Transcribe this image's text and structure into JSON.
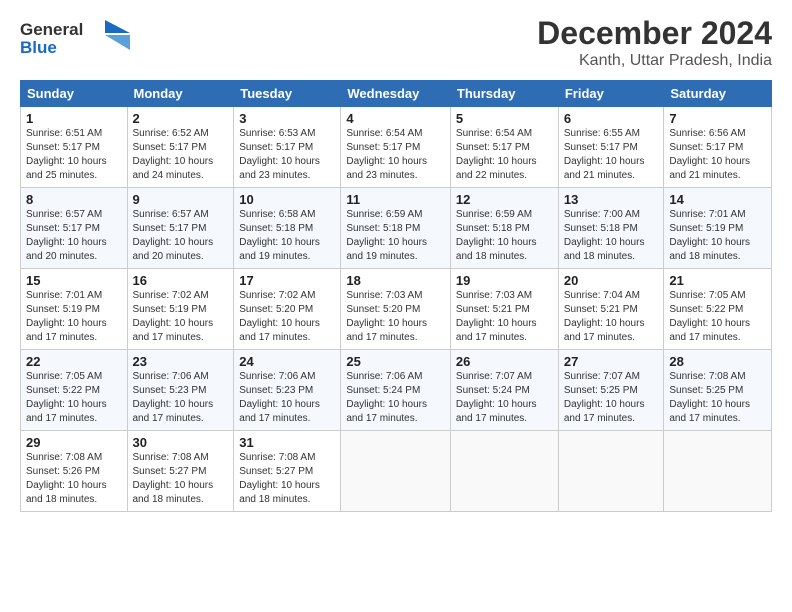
{
  "logo": {
    "line1": "General",
    "line2": "Blue"
  },
  "title": "December 2024",
  "subtitle": "Kanth, Uttar Pradesh, India",
  "headers": [
    "Sunday",
    "Monday",
    "Tuesday",
    "Wednesday",
    "Thursday",
    "Friday",
    "Saturday"
  ],
  "weeks": [
    [
      {
        "day": "1",
        "sunrise": "6:51 AM",
        "sunset": "5:17 PM",
        "daylight": "10 hours and 25 minutes."
      },
      {
        "day": "2",
        "sunrise": "6:52 AM",
        "sunset": "5:17 PM",
        "daylight": "10 hours and 24 minutes."
      },
      {
        "day": "3",
        "sunrise": "6:53 AM",
        "sunset": "5:17 PM",
        "daylight": "10 hours and 23 minutes."
      },
      {
        "day": "4",
        "sunrise": "6:54 AM",
        "sunset": "5:17 PM",
        "daylight": "10 hours and 23 minutes."
      },
      {
        "day": "5",
        "sunrise": "6:54 AM",
        "sunset": "5:17 PM",
        "daylight": "10 hours and 22 minutes."
      },
      {
        "day": "6",
        "sunrise": "6:55 AM",
        "sunset": "5:17 PM",
        "daylight": "10 hours and 21 minutes."
      },
      {
        "day": "7",
        "sunrise": "6:56 AM",
        "sunset": "5:17 PM",
        "daylight": "10 hours and 21 minutes."
      }
    ],
    [
      {
        "day": "8",
        "sunrise": "6:57 AM",
        "sunset": "5:17 PM",
        "daylight": "10 hours and 20 minutes."
      },
      {
        "day": "9",
        "sunrise": "6:57 AM",
        "sunset": "5:17 PM",
        "daylight": "10 hours and 20 minutes."
      },
      {
        "day": "10",
        "sunrise": "6:58 AM",
        "sunset": "5:18 PM",
        "daylight": "10 hours and 19 minutes."
      },
      {
        "day": "11",
        "sunrise": "6:59 AM",
        "sunset": "5:18 PM",
        "daylight": "10 hours and 19 minutes."
      },
      {
        "day": "12",
        "sunrise": "6:59 AM",
        "sunset": "5:18 PM",
        "daylight": "10 hours and 18 minutes."
      },
      {
        "day": "13",
        "sunrise": "7:00 AM",
        "sunset": "5:18 PM",
        "daylight": "10 hours and 18 minutes."
      },
      {
        "day": "14",
        "sunrise": "7:01 AM",
        "sunset": "5:19 PM",
        "daylight": "10 hours and 18 minutes."
      }
    ],
    [
      {
        "day": "15",
        "sunrise": "7:01 AM",
        "sunset": "5:19 PM",
        "daylight": "10 hours and 17 minutes."
      },
      {
        "day": "16",
        "sunrise": "7:02 AM",
        "sunset": "5:19 PM",
        "daylight": "10 hours and 17 minutes."
      },
      {
        "day": "17",
        "sunrise": "7:02 AM",
        "sunset": "5:20 PM",
        "daylight": "10 hours and 17 minutes."
      },
      {
        "day": "18",
        "sunrise": "7:03 AM",
        "sunset": "5:20 PM",
        "daylight": "10 hours and 17 minutes."
      },
      {
        "day": "19",
        "sunrise": "7:03 AM",
        "sunset": "5:21 PM",
        "daylight": "10 hours and 17 minutes."
      },
      {
        "day": "20",
        "sunrise": "7:04 AM",
        "sunset": "5:21 PM",
        "daylight": "10 hours and 17 minutes."
      },
      {
        "day": "21",
        "sunrise": "7:05 AM",
        "sunset": "5:22 PM",
        "daylight": "10 hours and 17 minutes."
      }
    ],
    [
      {
        "day": "22",
        "sunrise": "7:05 AM",
        "sunset": "5:22 PM",
        "daylight": "10 hours and 17 minutes."
      },
      {
        "day": "23",
        "sunrise": "7:06 AM",
        "sunset": "5:23 PM",
        "daylight": "10 hours and 17 minutes."
      },
      {
        "day": "24",
        "sunrise": "7:06 AM",
        "sunset": "5:23 PM",
        "daylight": "10 hours and 17 minutes."
      },
      {
        "day": "25",
        "sunrise": "7:06 AM",
        "sunset": "5:24 PM",
        "daylight": "10 hours and 17 minutes."
      },
      {
        "day": "26",
        "sunrise": "7:07 AM",
        "sunset": "5:24 PM",
        "daylight": "10 hours and 17 minutes."
      },
      {
        "day": "27",
        "sunrise": "7:07 AM",
        "sunset": "5:25 PM",
        "daylight": "10 hours and 17 minutes."
      },
      {
        "day": "28",
        "sunrise": "7:08 AM",
        "sunset": "5:25 PM",
        "daylight": "10 hours and 17 minutes."
      }
    ],
    [
      {
        "day": "29",
        "sunrise": "7:08 AM",
        "sunset": "5:26 PM",
        "daylight": "10 hours and 18 minutes."
      },
      {
        "day": "30",
        "sunrise": "7:08 AM",
        "sunset": "5:27 PM",
        "daylight": "10 hours and 18 minutes."
      },
      {
        "day": "31",
        "sunrise": "7:08 AM",
        "sunset": "5:27 PM",
        "daylight": "10 hours and 18 minutes."
      },
      null,
      null,
      null,
      null
    ]
  ]
}
